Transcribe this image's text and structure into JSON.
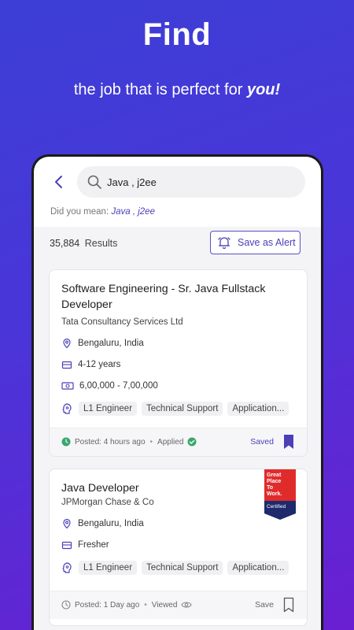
{
  "hero": {
    "title": "Find",
    "subtitle_pre": "the job that is perfect for ",
    "subtitle_em": "you!"
  },
  "search": {
    "query": "Java , j2ee"
  },
  "suggestion": {
    "prefix": "Did you mean:",
    "link": "Java , j2ee"
  },
  "results": {
    "count": "35,884",
    "label": "Results",
    "alert_label": "Save as Alert"
  },
  "jobs": [
    {
      "title": "Software Engineering - Sr. Java Fullstack Developer",
      "company": "Tata Consultancy Services Ltd",
      "location": "Bengaluru, India",
      "experience": "4-12 years",
      "salary": "6,00,000 - 7,00,000",
      "tags": [
        "L1 Engineer",
        "Technical Support",
        "Application..."
      ],
      "posted": "Posted: 4 hours ago",
      "status": "Applied",
      "save_label": "Saved"
    },
    {
      "title": "Java Developer",
      "company": "JPMorgan Chase & Co",
      "location": "Bengaluru, India",
      "experience": "Fresher",
      "tags": [
        "L1 Engineer",
        "Technical Support",
        "Application..."
      ],
      "posted": "Posted: 1 Day ago",
      "status": "Viewed",
      "save_label": "Save",
      "badge": {
        "line1": "Great",
        "line2": "Place",
        "line3": "To",
        "line4": "Work.",
        "line5": "Certified"
      }
    }
  ],
  "colors": {
    "accent": "#4c40b8",
    "gradient_start": "#3c3fd6",
    "gradient_end": "#6a1fd2",
    "applied_green": "#3aa76d"
  }
}
